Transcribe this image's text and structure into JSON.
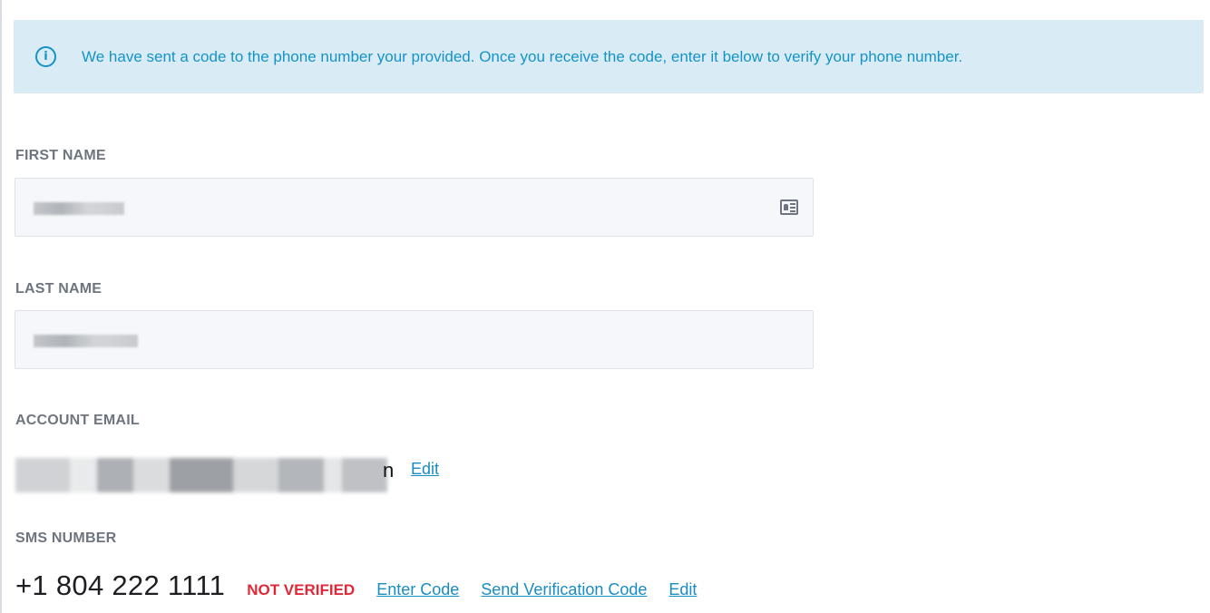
{
  "alert": {
    "icon": "info-icon",
    "message": "We have sent a code to the phone number your provided. Once you receive the code, enter it below to verify your phone number."
  },
  "first_name": {
    "label": "FIRST NAME",
    "value": "",
    "icon": "contact-card-icon"
  },
  "last_name": {
    "label": "LAST NAME",
    "value": ""
  },
  "account_email": {
    "label": "ACCOUNT EMAIL",
    "tail": "n",
    "edit_label": "Edit"
  },
  "sms": {
    "label": "SMS NUMBER",
    "number": "+1 804 222 1111",
    "status": "NOT VERIFIED",
    "enter_code_label": "Enter Code",
    "send_code_label": "Send Verification Code",
    "edit_label": "Edit"
  },
  "colors": {
    "accent": "#1a8cc2",
    "alert_bg": "#d9ecf6",
    "error": "#e02839",
    "label": "#6e7580"
  }
}
